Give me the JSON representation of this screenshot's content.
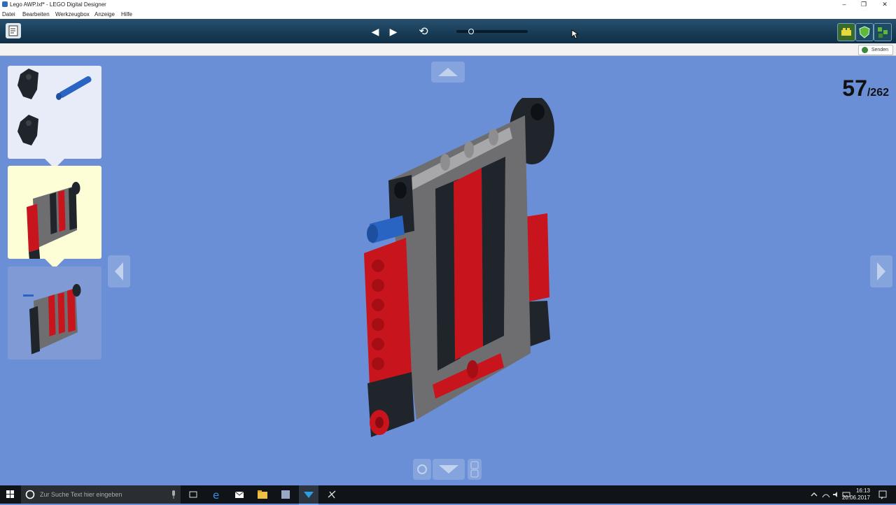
{
  "window": {
    "title": "Lego AWP.lxf* - LEGO Digital Designer",
    "controls": {
      "minimize": "–",
      "restore": "❐",
      "close": "✕"
    }
  },
  "menu": {
    "items": [
      "Datei",
      "Bearbeiten",
      "Werkzeugbox",
      "Anzeige",
      "Hilfe"
    ]
  },
  "toolbar": {
    "prev_icon": "◀",
    "next_icon": "▶",
    "rotate_icon": "⟲",
    "playback_position": 0.2
  },
  "subbar": {
    "send_label": "Senden"
  },
  "steps": {
    "current": "57",
    "total": "/262"
  },
  "taskbar": {
    "search_placeholder": "Zur Suche Text hier eingeben",
    "time": "16:13",
    "date": "20.06.2017"
  },
  "colors": {
    "stage_bg": "#6b8fd6",
    "brick_red": "#c8141c",
    "brick_gray": "#6e6e70",
    "brick_dark": "#1f252b",
    "brick_blue": "#2a64c2",
    "toolbar": "#17415c"
  }
}
